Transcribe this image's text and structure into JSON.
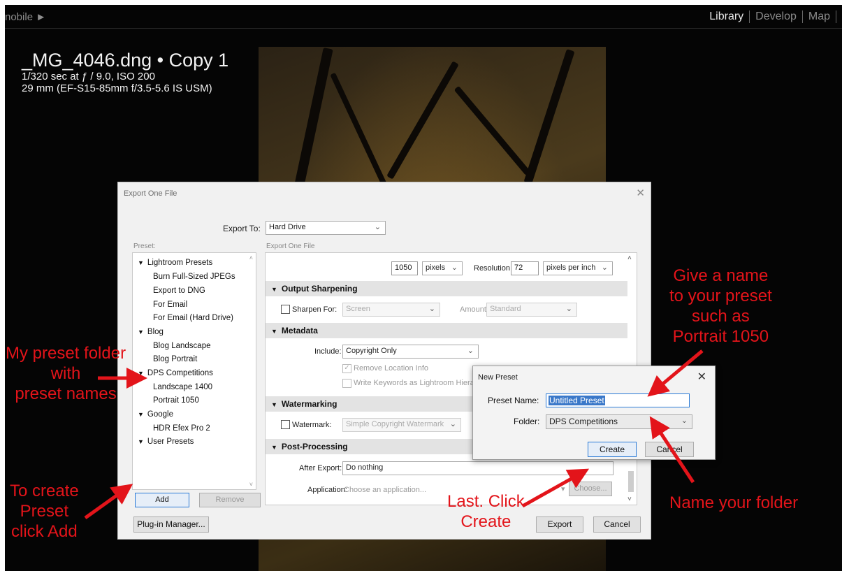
{
  "topbar": {
    "mobile_label": "nobile ►",
    "modules": [
      "Library",
      "Develop",
      "Map"
    ]
  },
  "photo_info": {
    "filename": "_MG_4046.dng • Copy 1",
    "exposure": "1/320 sec at ƒ / 9.0, ISO 200",
    "lens": "29 mm (EF-S15-85mm f/3.5-5.6 IS USM)"
  },
  "export_dialog": {
    "title": "Export One File",
    "export_to_label": "Export To:",
    "export_to_value": "Hard Drive",
    "preset_label": "Preset:",
    "panel_label": "Export One File",
    "presets": [
      {
        "label": "Lightroom Presets",
        "folder": true
      },
      {
        "label": "Burn Full-Sized JPEGs",
        "folder": false
      },
      {
        "label": "Export to DNG",
        "folder": false
      },
      {
        "label": "For Email",
        "folder": false
      },
      {
        "label": "For Email (Hard Drive)",
        "folder": false
      },
      {
        "label": "Blog",
        "folder": true
      },
      {
        "label": "Blog Landscape",
        "folder": false
      },
      {
        "label": "Blog Portrait",
        "folder": false
      },
      {
        "label": "DPS Competitions",
        "folder": true
      },
      {
        "label": "Landscape 1400",
        "folder": false
      },
      {
        "label": "Portrait 1050",
        "folder": false
      },
      {
        "label": "Google",
        "folder": true
      },
      {
        "label": "HDR Efex Pro 2",
        "folder": false
      },
      {
        "label": "User Presets",
        "folder": true
      }
    ],
    "add_button": "Add",
    "remove_button": "Remove",
    "plugin_button": "Plug-in Manager...",
    "export_button": "Export",
    "cancel_button": "Cancel",
    "size": {
      "value": "1050",
      "unit": "pixels",
      "resolution_label": "Resolution:",
      "resolution_value": "72",
      "resolution_unit": "pixels per inch"
    },
    "output_sharpening": {
      "title": "Output Sharpening",
      "sharpen_label": "Sharpen For:",
      "sharpen_value": "Screen",
      "amount_label": "Amount:",
      "amount_value": "Standard"
    },
    "metadata": {
      "title": "Metadata",
      "include_label": "Include:",
      "include_value": "Copyright Only",
      "remove_location": "Remove Location Info",
      "write_keywords": "Write Keywords as Lightroom Hierarchy"
    },
    "watermarking": {
      "title": "Watermarking",
      "watermark_label": "Watermark:",
      "watermark_value": "Simple Copyright Watermark"
    },
    "post_processing": {
      "title": "Post-Processing",
      "after_export_label": "After Export:",
      "after_export_value": "Do nothing",
      "application_label": "Application:",
      "application_placeholder": "Choose an application...",
      "choose_button": "Choose..."
    }
  },
  "new_preset_dialog": {
    "title": "New Preset",
    "name_label": "Preset Name:",
    "name_value": "Untitled Preset",
    "folder_label": "Folder:",
    "folder_value": "DPS Competitions",
    "create_button": "Create",
    "cancel_button": "Cancel"
  },
  "annotations": {
    "give_name": [
      "Give a name",
      "to your preset",
      "such as",
      "Portrait 1050"
    ],
    "my_folder": [
      "My preset folder",
      "with",
      "preset names"
    ],
    "to_create": [
      "To create",
      "Preset",
      "click Add"
    ],
    "last_click": [
      "Last. Click",
      "Create"
    ],
    "name_folder": "Name your folder"
  },
  "colors": {
    "annotation": "#e3141a",
    "focus": "#2a7ad6"
  }
}
